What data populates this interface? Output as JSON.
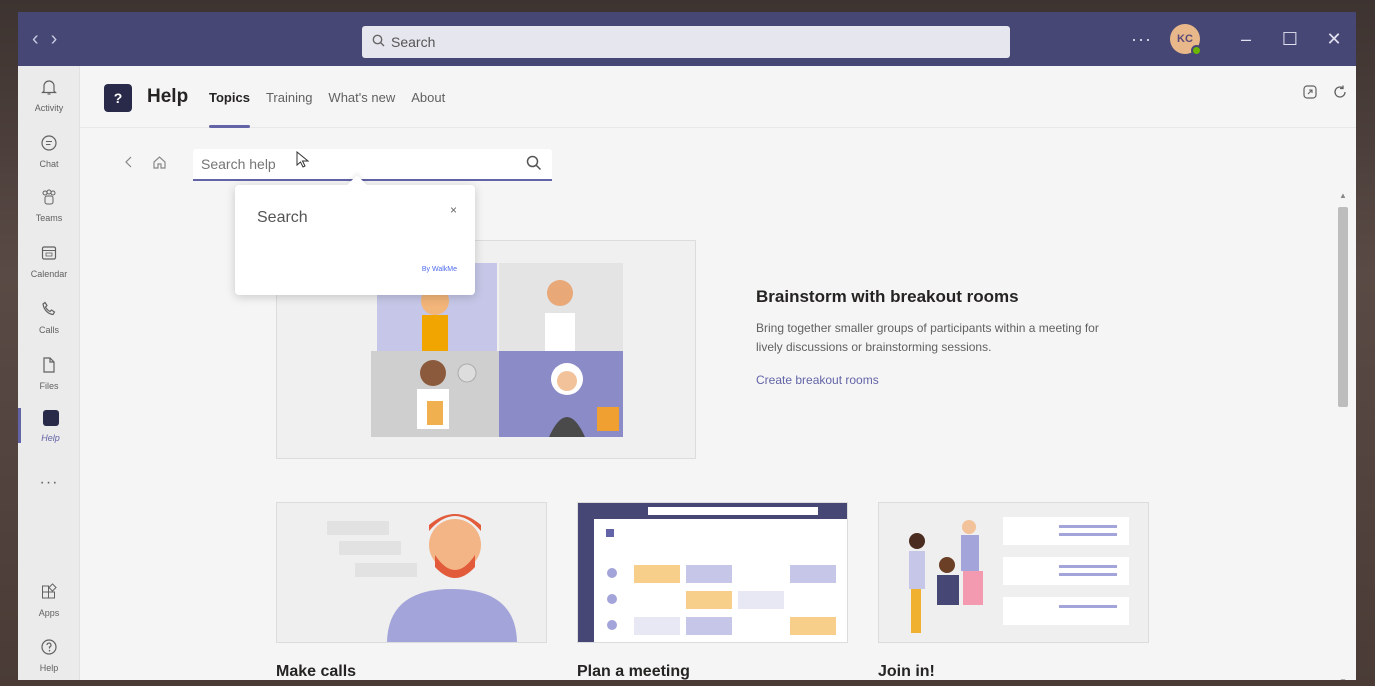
{
  "titlebar": {
    "back": "‹",
    "forward": "›",
    "search_placeholder": "Search",
    "more": "···",
    "avatar_initials": "KC",
    "minimize": "–",
    "maximize": "☐",
    "close": "✕"
  },
  "rail": {
    "items": [
      {
        "label": "Activity",
        "icon": "bell-icon"
      },
      {
        "label": "Chat",
        "icon": "chat-icon"
      },
      {
        "label": "Teams",
        "icon": "teams-icon"
      },
      {
        "label": "Calendar",
        "icon": "calendar-icon"
      },
      {
        "label": "Calls",
        "icon": "phone-icon"
      },
      {
        "label": "Files",
        "icon": "file-icon"
      },
      {
        "label": "Help",
        "icon": "help-app-icon"
      },
      {
        "label": "Apps",
        "icon": "apps-icon"
      },
      {
        "label": "Help",
        "icon": "question-icon"
      }
    ],
    "more": "···"
  },
  "header": {
    "app_title": "Help",
    "tabs": [
      "Topics",
      "Training",
      "What's new",
      "About"
    ],
    "active_tab": "Topics"
  },
  "content": {
    "search": {
      "placeholder": "Search help"
    },
    "popup": {
      "title": "Search",
      "close": "×",
      "brand": "By WalkMe"
    },
    "hero": {
      "title": "Brainstorm with breakout rooms",
      "description": "Bring together smaller groups of participants within a meeting for lively discussions or brainstorming sessions.",
      "link": "Create breakout rooms"
    },
    "cards": [
      {
        "title": "Make calls"
      },
      {
        "title": "Plan a meeting"
      },
      {
        "title": "Join in!"
      }
    ]
  },
  "colors": {
    "titlebar": "#464775",
    "accent": "#6264a7",
    "dark_tile": "#292a4a"
  }
}
